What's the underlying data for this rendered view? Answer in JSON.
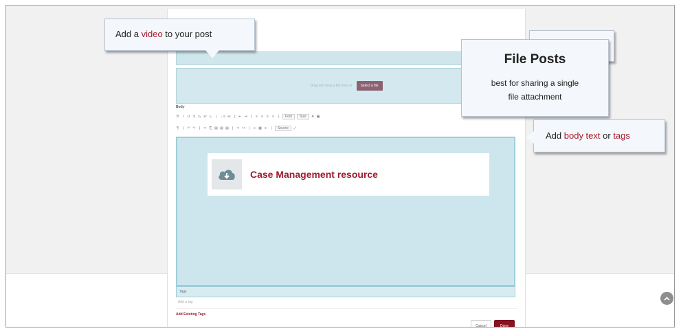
{
  "upload": {
    "drop_text": "Drag and drop a file here or",
    "select_button": "Select a file"
  },
  "editor": {
    "body_label": "Body",
    "toolbar_row1": [
      "B",
      "I",
      "U",
      "S",
      "x₂",
      "x²",
      "Iₓ",
      "|",
      "⋮≡",
      "•≡",
      "|",
      "⇤",
      "⇥",
      "|",
      "≡",
      "≡",
      "≡",
      "≡",
      "|"
    ],
    "font_select": "Font",
    "size_select": "Size",
    "text_color": "A",
    "bg_color": "▣",
    "toolbar_row2": [
      "¶",
      "|",
      "↶",
      "↷",
      "|",
      "✂",
      "⎘",
      "▤",
      "▤",
      "▤",
      "|",
      "⚭",
      "⚯",
      "|",
      "▭",
      "▦",
      "≡",
      "|"
    ],
    "source_button": "Source",
    "maximize": "⤢"
  },
  "resource": {
    "title": "Case Management resource",
    "icon": "cloud-download-icon"
  },
  "tags": {
    "label": "Tags",
    "placeholder": "Add a tag",
    "add_existing": "Add Existing Tags"
  },
  "actions": {
    "cancel": "Cancel",
    "done": "Done"
  },
  "callouts": {
    "video": {
      "prefix": "Add a ",
      "highlight": "video",
      "suffix": " to your post"
    },
    "file_posts": {
      "title": "File Posts",
      "description_line1": "best for sharing a single",
      "description_line2": "file attachment"
    },
    "body": {
      "prefix": "Add ",
      "highlight1": "body text",
      "middle": " or ",
      "highlight2": "tags"
    }
  },
  "colors": {
    "accent": "#9b1b2e",
    "drop_zone": "#d3e9ef",
    "callout_bg": "#f4f7fb"
  },
  "scroll_top": {
    "icon": "chevron-up-icon"
  }
}
